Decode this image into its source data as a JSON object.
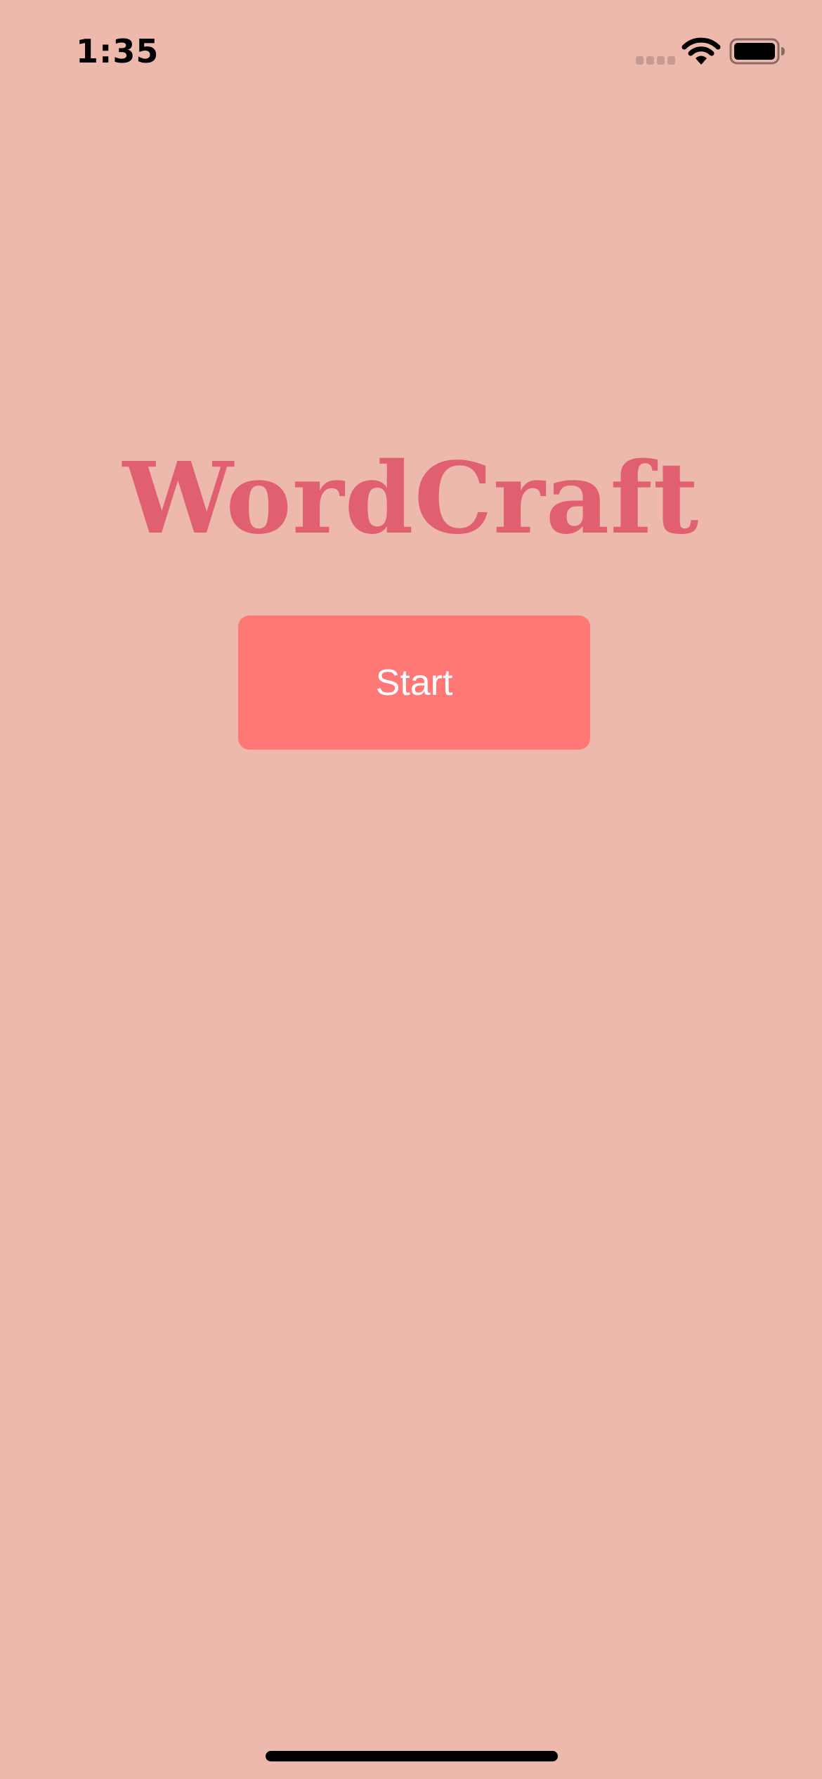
{
  "status_bar": {
    "time": "1:35",
    "signal_icon": "cellular-signal-icon",
    "wifi_icon": "wifi-icon",
    "battery_icon": "battery-icon"
  },
  "main": {
    "title": "WordCraft",
    "start_label": "Start"
  },
  "colors": {
    "background": "#EDB9AD",
    "title": "#E06070",
    "button": "#FF7876",
    "button_text": "#FFFFFF"
  }
}
